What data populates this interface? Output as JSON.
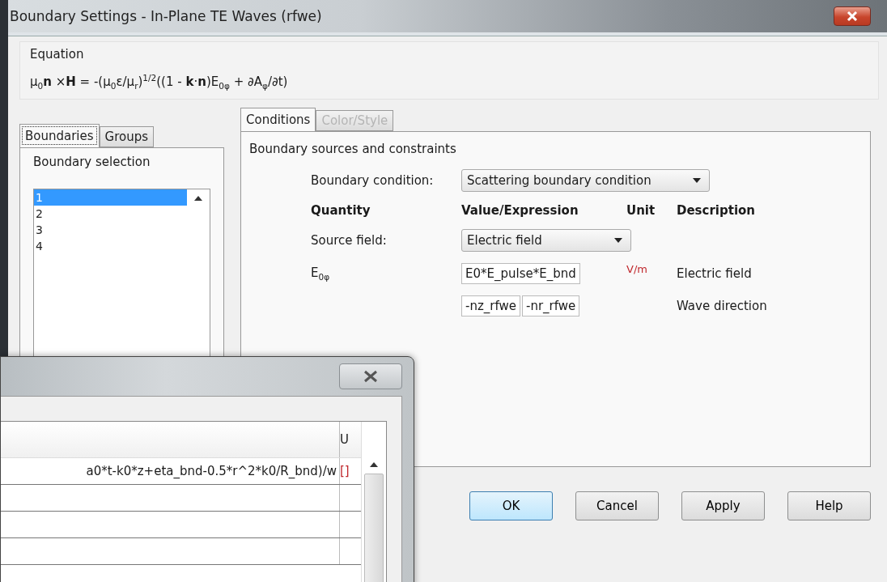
{
  "window": {
    "title": "Boundary Settings - In-Plane TE Waves (rfwe)"
  },
  "equation": {
    "label": "Equation",
    "formula": "μ$_{0}$**n** ×**H** = -(μ$_{0}$ε/μ$_{r}$)$^{1/2}$((1 - **k**·**n**)E$_{0φ}$ + ∂A$_{φ}$/∂t)"
  },
  "left_tabs": [
    {
      "label": "Boundaries",
      "selected": true
    },
    {
      "label": "Groups",
      "selected": false
    }
  ],
  "boundary_selection": {
    "label": "Boundary selection",
    "items": [
      {
        "label": "1",
        "selected": true
      },
      {
        "label": "2",
        "selected": false
      },
      {
        "label": "3",
        "selected": false
      },
      {
        "label": "4",
        "selected": false
      }
    ]
  },
  "right_tabs": [
    {
      "label": "Conditions",
      "selected": true,
      "disabled": false
    },
    {
      "label": "Color/Style",
      "selected": false,
      "disabled": true
    }
  ],
  "constraints": {
    "title": "Boundary sources and constraints",
    "boundary_condition": {
      "label": "Boundary condition:",
      "value": "Scattering boundary condition"
    },
    "columns": [
      "Quantity",
      "Value/Expression",
      "Unit",
      "Description"
    ],
    "rows": [
      {
        "kind": "dropdown",
        "label": "Source field:",
        "value": "Electric field"
      },
      {
        "kind": "input",
        "label": "E$_{0φ}$",
        "values": [
          "E0*E_pulse*E_bnd"
        ],
        "unit": "V/m",
        "description": "Electric field"
      },
      {
        "kind": "input",
        "values": [
          "-nz_rfwe",
          "-nr_rfwe"
        ],
        "description": "Wave direction"
      }
    ]
  },
  "buttons": [
    {
      "label": "OK",
      "default": true
    },
    {
      "label": "Cancel",
      "default": false
    },
    {
      "label": "Apply",
      "default": false
    },
    {
      "label": "Help",
      "default": false
    }
  ],
  "overlay_window": {
    "columns": [
      "U"
    ],
    "rows": [
      {
        "expression": "a0*t-k0*z+eta_bnd-0.5*r^2*k0/R_bnd)/w",
        "unit": "[]"
      }
    ]
  }
}
